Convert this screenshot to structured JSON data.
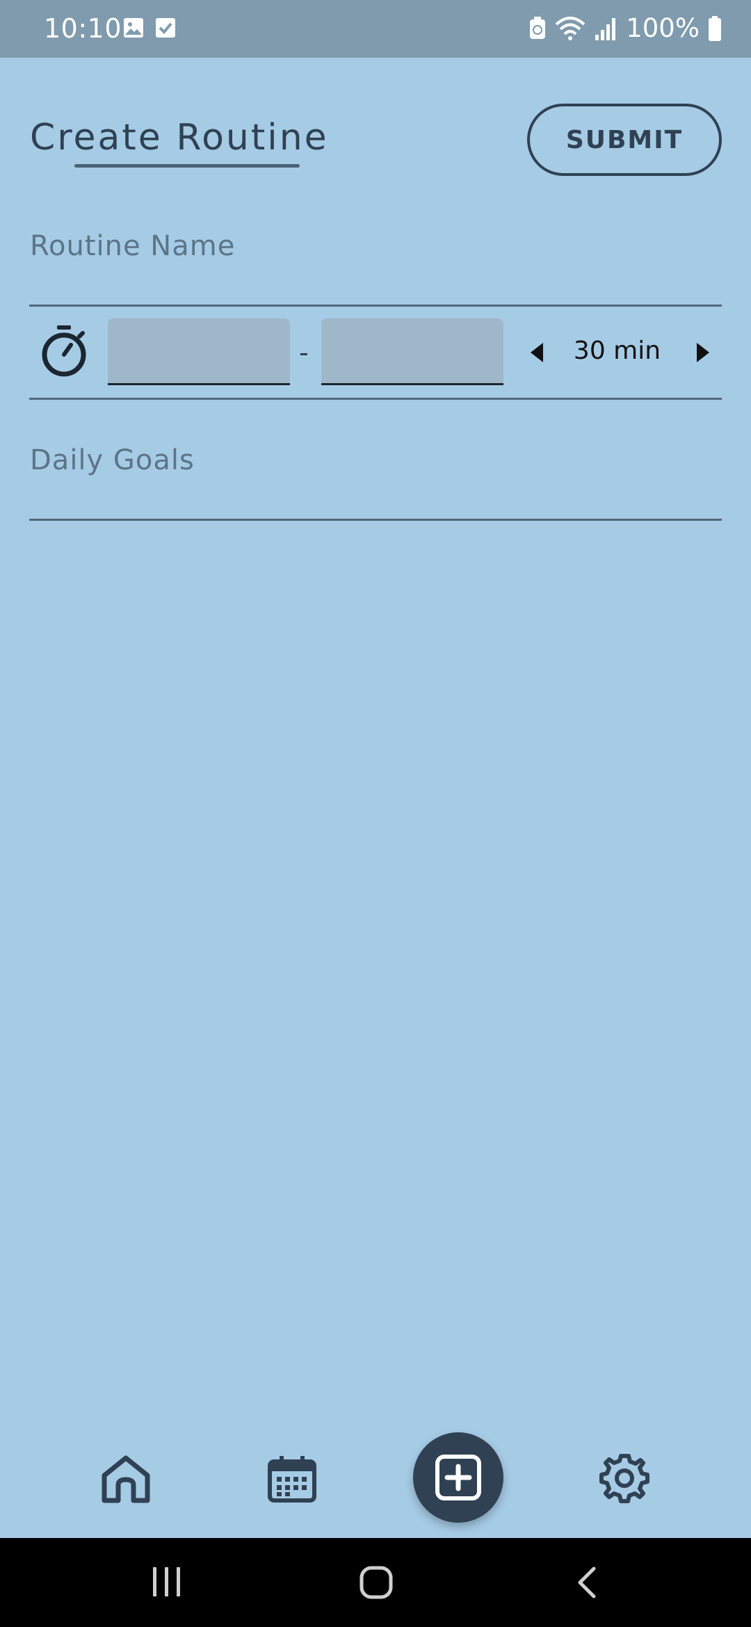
{
  "status_bar": {
    "time": "10:10",
    "battery": "100%",
    "icons": [
      "gallery-icon",
      "check-square-icon",
      "battery-saver-icon",
      "wifi-icon",
      "signal-icon",
      "battery-icon"
    ]
  },
  "header": {
    "title": "Create Routine",
    "submit_label": "SUBMIT"
  },
  "form": {
    "routine_name_placeholder": "Routine Name",
    "start_time": "",
    "time_separator": "-",
    "end_time": "",
    "duration": "30 min",
    "daily_goals_placeholder": "Daily Goals"
  },
  "bottom_nav": {
    "items": [
      "home-icon",
      "calendar-icon",
      "add-icon",
      "settings-icon"
    ]
  },
  "colors": {
    "background": "#a6cbe5",
    "status_bar": "#7f9bad",
    "primary_dark": "#2f4153",
    "placeholder": "#5b7488",
    "input_fill": "#9fb8c9"
  }
}
